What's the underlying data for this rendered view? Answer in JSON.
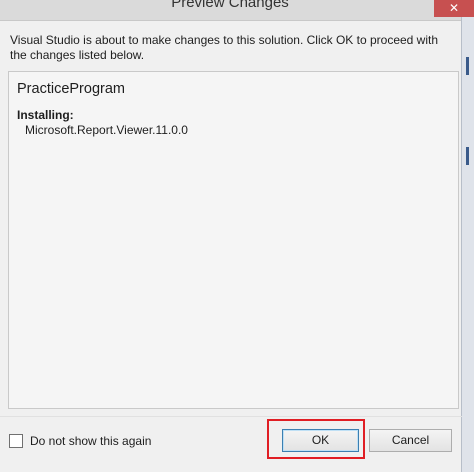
{
  "window": {
    "title": "Preview Changes",
    "close_label": "✕"
  },
  "message": "Visual Studio is about to make changes to this solution. Click OK to proceed with the changes listed below.",
  "preview": {
    "project_name": "PracticeProgram",
    "section_label": "Installing:",
    "packages": [
      "Microsoft.Report.Viewer.11.0.0"
    ]
  },
  "footer": {
    "checkbox_label": "Do not show this again",
    "checkbox_checked": false,
    "ok_label": "OK",
    "cancel_label": "Cancel"
  },
  "colors": {
    "highlight": "#e01e24",
    "close_button": "#c75050"
  }
}
